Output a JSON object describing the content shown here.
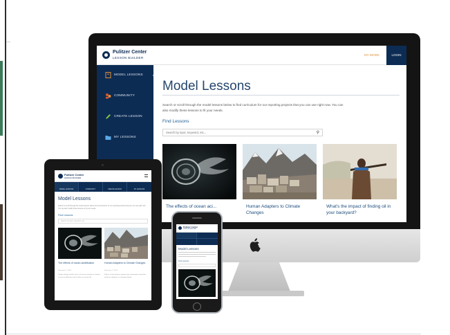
{
  "desktop": {
    "header": {
      "logo_title": "Pulitzer Center",
      "logo_subtitle": "LESSON BUILDER",
      "my_work": "MY WORK",
      "login": "LOGIN"
    },
    "sidebar": {
      "items": [
        {
          "label": "MODEL LESSONS",
          "icon": "book-icon",
          "icon_color": "#e0913a",
          "active": true
        },
        {
          "label": "COMMUNITY",
          "icon": "community-icon",
          "icon_color": "#d8572a"
        },
        {
          "label": "CREATE LESSON",
          "icon": "pencil-icon",
          "icon_color": "#7bc043"
        },
        {
          "label": "MY LESSONS",
          "icon": "folder-icon",
          "icon_color": "#5aa9e6"
        }
      ]
    },
    "main": {
      "title": "Model Lessons",
      "intro": "Search or scroll through the model lessons below to find curriculum for our reporting projects that you can use right now. You can also modify these lessons to fit your needs.",
      "find_label": "Find Lessons",
      "search_placeholder": "Search by topic, keyword, etc...",
      "cards": [
        {
          "title": "The effects of ocean aci...",
          "image": "sea-butterfly-image"
        },
        {
          "title": "Human Adapters to Climate Changes",
          "image": "mountain-village-image"
        },
        {
          "title": "What's the impact of finding oil in your backyard?",
          "image": "man-with-rifle-image"
        }
      ]
    }
  },
  "tablet": {
    "logo_title": "Pulitzer Center",
    "logo_subtitle": "LESSON BUILDER",
    "nav": [
      "MODEL LESSONS",
      "COMMUNITY",
      "CREATE LESSON",
      "MY LESSONS"
    ],
    "title": "Model Lessons",
    "intro": "Search or scroll through the model lessons below to find curriculum for our reporting projects that you can use right now. You can also modify these lessons to fit your needs.",
    "find_label": "Find Lessons",
    "search_placeholder": "Search by topic, keyword, etc...",
    "cards": [
      {
        "title": "The effects of ocean acidification",
        "meta": "Resources 1 / 2016",
        "body": "Climate change and the ocean: this lesson introduces students to ocean acidification and its effects on marine life."
      },
      {
        "title": "Human Adapters to Climate Changes",
        "meta": "Resources 1 / 2016",
        "body": "Pulitzer Center grantees explore how communities around the world are adapting to a changing climate."
      }
    ]
  },
  "phone": {
    "logo_title": "Pulitzer Center",
    "logo_subtitle": "LESSON BUILDER",
    "title": "Model Lessons",
    "find_label": "Find Lessons"
  },
  "colors": {
    "navy": "#0d2c54",
    "accent": "#e0913a",
    "link": "#1c4c7c"
  }
}
